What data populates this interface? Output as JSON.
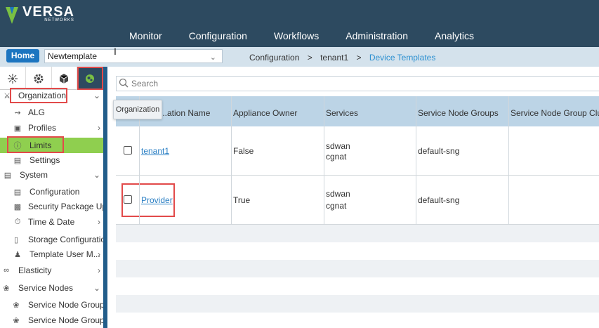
{
  "brand": {
    "name": "VERSA",
    "sub": "NETWORKS"
  },
  "nav": [
    "Monitor",
    "Configuration",
    "Workflows",
    "Administration",
    "Analytics"
  ],
  "breadcrumb_bar": {
    "home_label": "Home",
    "template_value": "Newtemplate",
    "crumbs": [
      "Configuration",
      "tenant1",
      "Device Templates"
    ]
  },
  "sidebar": {
    "tabs": [
      "network-tab",
      "settings-tab",
      "box-tab",
      "services-tab"
    ],
    "items": [
      {
        "label": "Organization",
        "icon": "org-tree-icon",
        "expand": "collapse"
      },
      {
        "label": "ALG",
        "icon": "alg-icon"
      },
      {
        "label": "Profiles",
        "icon": "profiles-icon",
        "expand": "expand"
      },
      {
        "label": "Limits",
        "icon": "limits-icon"
      },
      {
        "label": "Settings",
        "icon": "settings-icon"
      },
      {
        "label": "System",
        "icon": "system-icon",
        "expand": "collapse"
      },
      {
        "label": "Configuration",
        "icon": "config-icon"
      },
      {
        "label": "Security Package Up...",
        "icon": "security-package-icon"
      },
      {
        "label": "Time & Date",
        "icon": "clock-icon",
        "expand": "expand"
      },
      {
        "label": "Storage Configurations",
        "icon": "storage-icon"
      },
      {
        "label": "Template User M...",
        "icon": "users-icon",
        "expand": "expand"
      },
      {
        "label": "Elasticity",
        "icon": "elasticity-icon",
        "expand": "expand"
      },
      {
        "label": "Service Nodes",
        "icon": "service-nodes-icon",
        "expand": "collapse"
      },
      {
        "label": "Service Node Groups",
        "icon": "service-node-groups-icon"
      },
      {
        "label": "Service Node Group ...",
        "icon": "service-node-group-cluster-icon"
      }
    ]
  },
  "search": {
    "placeholder": "Search"
  },
  "tooltip": "Organization",
  "table": {
    "columns": [
      "...ation Name",
      "Appliance Owner",
      "Services",
      "Service Node Groups",
      "Service Node Group Clus..."
    ],
    "rows": [
      {
        "name": "tenant1",
        "owner": "False",
        "services": [
          "sdwan",
          "cgnat"
        ],
        "sng": "default-sng"
      },
      {
        "name": "Provider",
        "owner": "True",
        "services": [
          "sdwan",
          "cgnat"
        ],
        "sng": "default-sng"
      }
    ]
  },
  "colors": {
    "header": "#2d4a60",
    "accent": "#1c75c0",
    "highlight": "#8fcf4f",
    "annotation": "#e24a4a"
  }
}
